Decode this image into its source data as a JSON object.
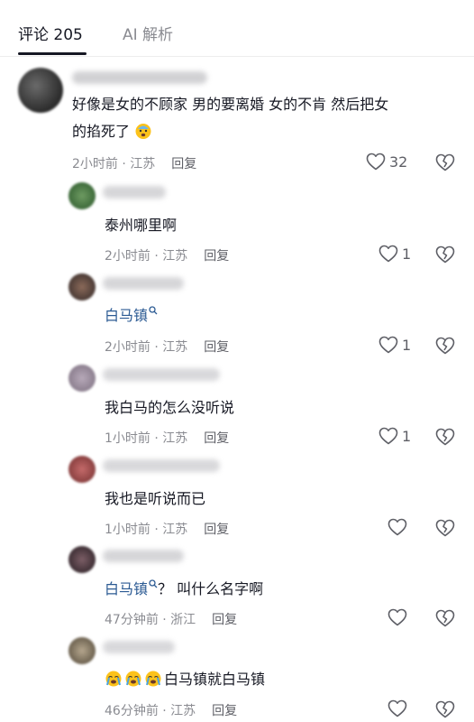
{
  "tabs": [
    {
      "label": "评论 205"
    },
    {
      "label": "AI 解析"
    }
  ],
  "comments": [
    {
      "text_line1": "好像是女的不顾家 男的要离婚 女的不肯 然后把女",
      "text_line2": "的掐死了",
      "time": "2小时前 · 江苏",
      "reply_label": "回复",
      "likes": "32"
    },
    {
      "text": "泰州哪里啊",
      "time": "2小时前 · 江苏",
      "reply_label": "回复",
      "likes": "1"
    },
    {
      "link_text": "白马镇",
      "time": "2小时前 · 江苏",
      "reply_label": "回复",
      "likes": "1"
    },
    {
      "text": "我白马的怎么没听说",
      "time": "1小时前 · 江苏",
      "reply_label": "回复",
      "likes": "1"
    },
    {
      "text": "我也是听说而已",
      "time": "1小时前 · 江苏",
      "reply_label": "回复",
      "likes": ""
    },
    {
      "link_text": "白马镇",
      "text_after": "？ 叫什么名字啊",
      "time": "47分钟前 · 浙江",
      "reply_label": "回复",
      "likes": ""
    },
    {
      "text": "白马镇就白马镇",
      "time": "46分钟前 · 江苏",
      "reply_label": "回复",
      "likes": ""
    }
  ],
  "colors": {
    "text": "#161823",
    "muted": "#8a8b91",
    "link": "#2b5a93"
  },
  "icons": {
    "like": "heart-outline-icon",
    "dislike": "broken-heart-icon",
    "search_hint": "search-icon",
    "emoji_sweat": "anxious-sweat-emoji",
    "emoji_cry": "loudly-crying-emoji"
  }
}
